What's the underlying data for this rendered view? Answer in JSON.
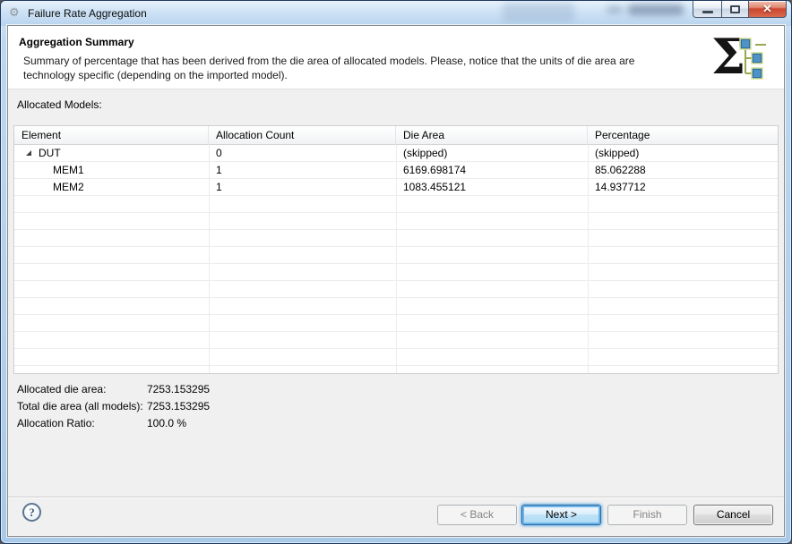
{
  "window": {
    "title": "Failure Rate Aggregation",
    "controls": {
      "minimize": "minimize",
      "maximize": "maximize",
      "close": "✕"
    }
  },
  "header": {
    "title": "Aggregation Summary",
    "description": "Summary of percentage that has been derived from the die area of allocated models. Please, notice that the units of die area are technology specific (depending on the imported model).",
    "icon": "sigma-hierarchy-icon",
    "sigma_glyph": "Σ"
  },
  "models_label": "Allocated Models:",
  "table": {
    "columns": [
      "Element",
      "Allocation Count",
      "Die Area",
      "Percentage"
    ],
    "rows": [
      {
        "element": "DUT",
        "expanded": true,
        "allocation_count": "0",
        "die_area": "(skipped)",
        "percentage": "(skipped)"
      },
      {
        "element": "MEM1",
        "expanded": false,
        "allocation_count": "1",
        "die_area": "6169.698174",
        "percentage": "85.062288"
      },
      {
        "element": "MEM2",
        "expanded": false,
        "allocation_count": "1",
        "die_area": "1083.455121",
        "percentage": "14.937712"
      }
    ]
  },
  "summary": {
    "rows": [
      {
        "label": "Allocated die area:",
        "value": "7253.153295"
      },
      {
        "label": "Total die area (all models):",
        "value": "7253.153295"
      },
      {
        "label": "Allocation Ratio:",
        "value": "100.0 %"
      }
    ]
  },
  "buttons": {
    "help": "?",
    "back": "< Back",
    "next": "Next >",
    "finish": "Finish",
    "cancel": "Cancel"
  },
  "colors": {
    "glass_blue": "#b3d0ec",
    "close_red": "#cc4730",
    "focus_blue": "#6db3e8",
    "content_gray": "#f0f0f0",
    "grid_line": "#ededed",
    "disabled_text": "#838383",
    "icon_node_blue": "#2d6ca3",
    "icon_node_outline": "#c8d96e"
  }
}
